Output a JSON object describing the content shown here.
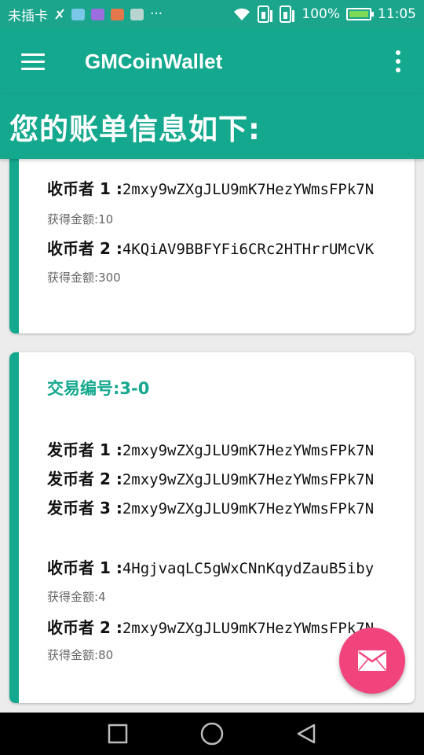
{
  "status_bar": {
    "carrier": "未插卡",
    "dots": "···",
    "battery_percent": "100%",
    "time": "11:05",
    "colors": {
      "bar": "#1aa58c",
      "mini_icons": [
        "#7bc7e8",
        "#9b6ddf",
        "#e4774b",
        "#b8d6cf"
      ]
    }
  },
  "toolbar": {
    "menu_icon": "menu-icon",
    "title": "GMCoinWallet",
    "more_icon": "more-vert-icon"
  },
  "header": {
    "title": "您的账单信息如下:"
  },
  "cards": [
    {
      "receivers": [
        {
          "label": "收币者 1 :",
          "address": "2mxy9wZXgJLU9mK7HezYWmsFPk7N",
          "amount_label": "获得金额:",
          "amount": "10"
        },
        {
          "label": "收币者 2 :",
          "address": "4KQiAV9BBFYFi6CRc2HTHrrUMcVK",
          "amount_label": "获得金额:",
          "amount": "300"
        }
      ]
    },
    {
      "tx_label": "交易编号:",
      "tx_id": "3-0",
      "senders": [
        {
          "label": "发币者 1 :",
          "address": "2mxy9wZXgJLU9mK7HezYWmsFPk7N"
        },
        {
          "label": "发币者 2 :",
          "address": "2mxy9wZXgJLU9mK7HezYWmsFPk7N"
        },
        {
          "label": "发币者 3 :",
          "address": "2mxy9wZXgJLU9mK7HezYWmsFPk7N"
        }
      ],
      "receivers": [
        {
          "label": "收币者 1 :",
          "address": "4HgjvaqLC5gWxCNnKqydZauB5iby",
          "amount_label": "获得金额:",
          "amount": "4"
        },
        {
          "label": "收币者 2 :",
          "address": "2mxy9wZXgJLU9mK7HezYWmsFPk7N",
          "amount_label": "获得金额:",
          "amount": "80"
        }
      ]
    }
  ],
  "fab": {
    "icon": "mail-icon",
    "color": "#f2447c"
  },
  "nav": {
    "icons": [
      "square-recents-icon",
      "circle-home-icon",
      "triangle-back-icon"
    ]
  },
  "theme": {
    "primary": "#14a88e",
    "accent": "#f2447c"
  }
}
